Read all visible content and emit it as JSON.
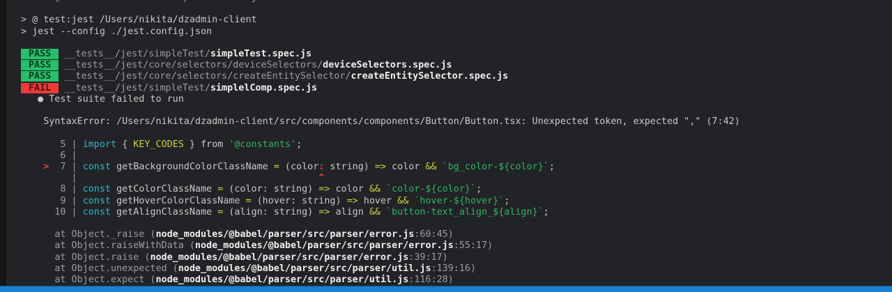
{
  "colors": {
    "background": "#222326",
    "status_bar_blue": "#1b80d4",
    "pass_green": "#27bf69",
    "fail_red": "#eb3a3a",
    "error_red": "#ef4040",
    "keyword_cyan": "#2db9cd",
    "operator_yellow": "#cecf43",
    "string_green": "#33b267"
  },
  "terminal": {
    "lines": [
      {
        "name": "shell-prompt-line",
        "tokens": [
          [
            "dim",
            "nikita@asd dzadmin-client % npm run test:jest --watch"
          ]
        ]
      },
      {
        "name": "blank-line",
        "tokens": []
      },
      {
        "name": "npm-script-line",
        "tokens": [
          [
            "fg",
            "> @ test:jest /Users/nikita/dzadmin-client"
          ]
        ]
      },
      {
        "name": "jest-command-line",
        "tokens": [
          [
            "fg",
            "> jest --config ./jest.config.json"
          ]
        ]
      },
      {
        "name": "blank-line",
        "tokens": []
      },
      {
        "name": "test-result-pass-1",
        "tokens": [
          [
            "badge-pass",
            "PASS"
          ],
          [
            "dim",
            " __tests__/jest/simpleTest/"
          ],
          [
            "boldwhite",
            "simpleTest.spec.js"
          ]
        ]
      },
      {
        "name": "test-result-pass-2",
        "tokens": [
          [
            "badge-pass",
            "PASS"
          ],
          [
            "dim",
            " __tests__/jest/core/selectors/deviceSelectors/"
          ],
          [
            "boldwhite",
            "deviceSelectors.spec.js"
          ]
        ]
      },
      {
        "name": "test-result-pass-3",
        "tokens": [
          [
            "badge-pass",
            "PASS"
          ],
          [
            "dim",
            " __tests__/jest/core/selectors/createEntitySelector/"
          ],
          [
            "boldwhite",
            "createEntitySelector.spec.js"
          ]
        ]
      },
      {
        "name": "test-result-fail-1",
        "tokens": [
          [
            "badge-fail",
            "FAIL"
          ],
          [
            "dim",
            " __tests__/jest/simpleTest/"
          ],
          [
            "boldwhite",
            "simplelComp.spec.js"
          ]
        ]
      },
      {
        "name": "failure-summary-line",
        "tokens": [
          [
            "fg",
            "   ● Test suite failed to run"
          ]
        ]
      },
      {
        "name": "blank-line",
        "tokens": []
      },
      {
        "name": "syntax-error-line",
        "tokens": [
          [
            "fg",
            "    SyntaxError: /Users/nikita/dzadmin-client/src/components/components/Button/Button.tsx: Unexpected token, expected \",\" (7:42)"
          ]
        ]
      },
      {
        "name": "blank-line",
        "tokens": []
      },
      {
        "name": "code-frame-line-5",
        "tokens": [
          [
            "dim",
            "       5 | "
          ],
          [
            "cyan",
            "import"
          ],
          [
            "fg",
            " { "
          ],
          [
            "yellow",
            "KEY_CODES"
          ],
          [
            "fg",
            " } from "
          ],
          [
            "green",
            "'@constants'"
          ],
          [
            "fg",
            ";"
          ]
        ]
      },
      {
        "name": "code-frame-line-6",
        "tokens": [
          [
            "dim",
            "       6 |"
          ]
        ]
      },
      {
        "name": "code-frame-line-7",
        "tokens": [
          [
            "red",
            "    >"
          ],
          [
            "dim",
            "  7 | "
          ],
          [
            "cyan",
            "const"
          ],
          [
            "fg",
            " getBackgroundColorClassName "
          ],
          [
            "yellow",
            "="
          ],
          [
            "fg",
            " (color"
          ],
          [
            "red",
            ":"
          ],
          [
            "fg",
            " string) "
          ],
          [
            "yellow",
            "=>"
          ],
          [
            "fg",
            " color "
          ],
          [
            "yellow",
            "&&"
          ],
          [
            "fg",
            " "
          ],
          [
            "green",
            "`bg_color-${color}`"
          ],
          [
            "fg",
            ";"
          ]
        ]
      },
      {
        "name": "code-frame-caret-line",
        "tokens": [
          [
            "dim",
            "         | "
          ],
          [
            "red",
            "                                          ^"
          ]
        ]
      },
      {
        "name": "code-frame-line-8",
        "tokens": [
          [
            "dim",
            "       8 | "
          ],
          [
            "cyan",
            "const"
          ],
          [
            "fg",
            " getColorClassName "
          ],
          [
            "yellow",
            "="
          ],
          [
            "fg",
            " (color: string) "
          ],
          [
            "yellow",
            "=>"
          ],
          [
            "fg",
            " color "
          ],
          [
            "yellow",
            "&&"
          ],
          [
            "fg",
            " "
          ],
          [
            "green",
            "`color-${color}`"
          ],
          [
            "fg",
            ";"
          ]
        ]
      },
      {
        "name": "code-frame-line-9",
        "tokens": [
          [
            "dim",
            "       9 | "
          ],
          [
            "cyan",
            "const"
          ],
          [
            "fg",
            " getHoverColorClassName "
          ],
          [
            "yellow",
            "="
          ],
          [
            "fg",
            " (hover: string) "
          ],
          [
            "yellow",
            "=>"
          ],
          [
            "fg",
            " hover "
          ],
          [
            "yellow",
            "&&"
          ],
          [
            "fg",
            " "
          ],
          [
            "green",
            "`hover-${hover}`"
          ],
          [
            "fg",
            ";"
          ]
        ]
      },
      {
        "name": "code-frame-line-10",
        "tokens": [
          [
            "dim",
            "      10 | "
          ],
          [
            "cyan",
            "const"
          ],
          [
            "fg",
            " getAlignClassName "
          ],
          [
            "yellow",
            "="
          ],
          [
            "fg",
            " (align: string) "
          ],
          [
            "yellow",
            "=>"
          ],
          [
            "fg",
            " align "
          ],
          [
            "yellow",
            "&&"
          ],
          [
            "fg",
            " "
          ],
          [
            "green",
            "`button-text_align_${align}`"
          ],
          [
            "fg",
            ";"
          ]
        ]
      },
      {
        "name": "blank-line",
        "tokens": []
      },
      {
        "name": "stack-trace-line-1",
        "tokens": [
          [
            "dim",
            "      at Object._raise ("
          ],
          [
            "boldwhite",
            "node_modules/@babel/parser/src/parser/error.js"
          ],
          [
            "dim",
            ":60:45)"
          ]
        ]
      },
      {
        "name": "stack-trace-line-2",
        "tokens": [
          [
            "dim",
            "      at Object.raiseWithData ("
          ],
          [
            "boldwhite",
            "node_modules/@babel/parser/src/parser/error.js"
          ],
          [
            "dim",
            ":55:17)"
          ]
        ]
      },
      {
        "name": "stack-trace-line-3",
        "tokens": [
          [
            "dim",
            "      at Object.raise ("
          ],
          [
            "boldwhite",
            "node_modules/@babel/parser/src/parser/error.js"
          ],
          [
            "dim",
            ":39:17)"
          ]
        ]
      },
      {
        "name": "stack-trace-line-4",
        "tokens": [
          [
            "dim",
            "      at Object.unexpected ("
          ],
          [
            "boldwhite",
            "node_modules/@babel/parser/src/parser/util.js"
          ],
          [
            "dim",
            ":139:16)"
          ]
        ]
      },
      {
        "name": "stack-trace-line-5",
        "tokens": [
          [
            "dim",
            "      at Object.expect ("
          ],
          [
            "boldwhite",
            "node_modules/@babel/parser/src/parser/util.js"
          ],
          [
            "dim",
            ":116:28)"
          ]
        ]
      }
    ]
  }
}
